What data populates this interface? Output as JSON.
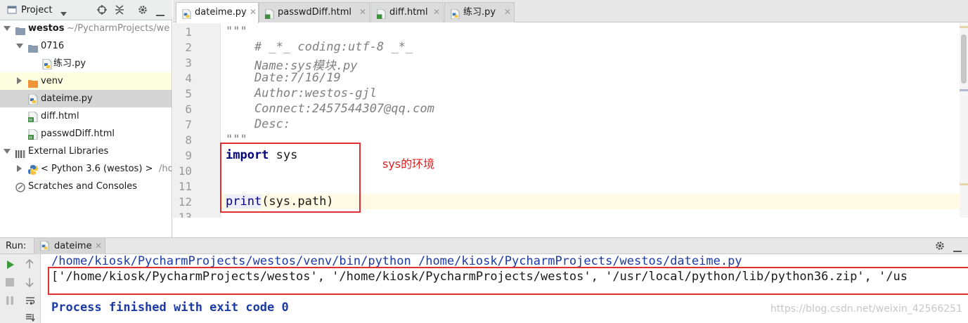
{
  "project": {
    "title": "Project",
    "tree": [
      {
        "label": "westos",
        "suffix": "~/PycharmProjects/we"
      },
      {
        "label": "0716"
      },
      {
        "label": "练习.py"
      },
      {
        "label": "venv"
      },
      {
        "label": "dateime.py"
      },
      {
        "label": "diff.html"
      },
      {
        "label": "passwdDiff.html"
      },
      {
        "label": "External Libraries"
      },
      {
        "label": "< Python 3.6 (westos) >",
        "suffix": "/ho"
      },
      {
        "label": "Scratches and Consoles"
      }
    ]
  },
  "tabs": [
    {
      "label": "dateime.py",
      "active": true
    },
    {
      "label": "passwdDiff.html"
    },
    {
      "label": "diff.html"
    },
    {
      "label": "练习.py"
    }
  ],
  "editor": {
    "line_numbers": [
      "1",
      "2",
      "3",
      "4",
      "5",
      "6",
      "7",
      "8",
      "9",
      "10",
      "11",
      "12",
      "13"
    ],
    "lines": {
      "l1": "\"\"\"",
      "l2": "    # _*_ coding:utf-8 _*_",
      "l3": "    Name:sys模块.py",
      "l4": "    Date:7/16/19",
      "l5": "    Author:westos-gjl",
      "l6": "    Connect:2457544307@qq.com",
      "l7": "    Desc:",
      "l8": "\"\"\"",
      "l9_kw": "import",
      "l9_rest": " sys",
      "l12_fn": "print",
      "l12_rest": "(sys.path)"
    },
    "annotation": "sys的环境"
  },
  "run": {
    "label": "Run:",
    "tab_label": "dateime",
    "console": {
      "command": "/home/kiosk/PycharmProjects/westos/venv/bin/python /home/kiosk/PycharmProjects/westos/dateime.py",
      "output": "['/home/kiosk/PycharmProjects/westos', '/home/kiosk/PycharmProjects/westos', '/usr/local/python/lib/python36.zip', '/us",
      "exit": "Process finished with exit code 0"
    }
  },
  "watermark": "https://blog.csdn.net/weixin_42566251",
  "colors": {
    "annotation_red": "#e02020",
    "keyword": "#000080",
    "docstring": "#808080"
  }
}
